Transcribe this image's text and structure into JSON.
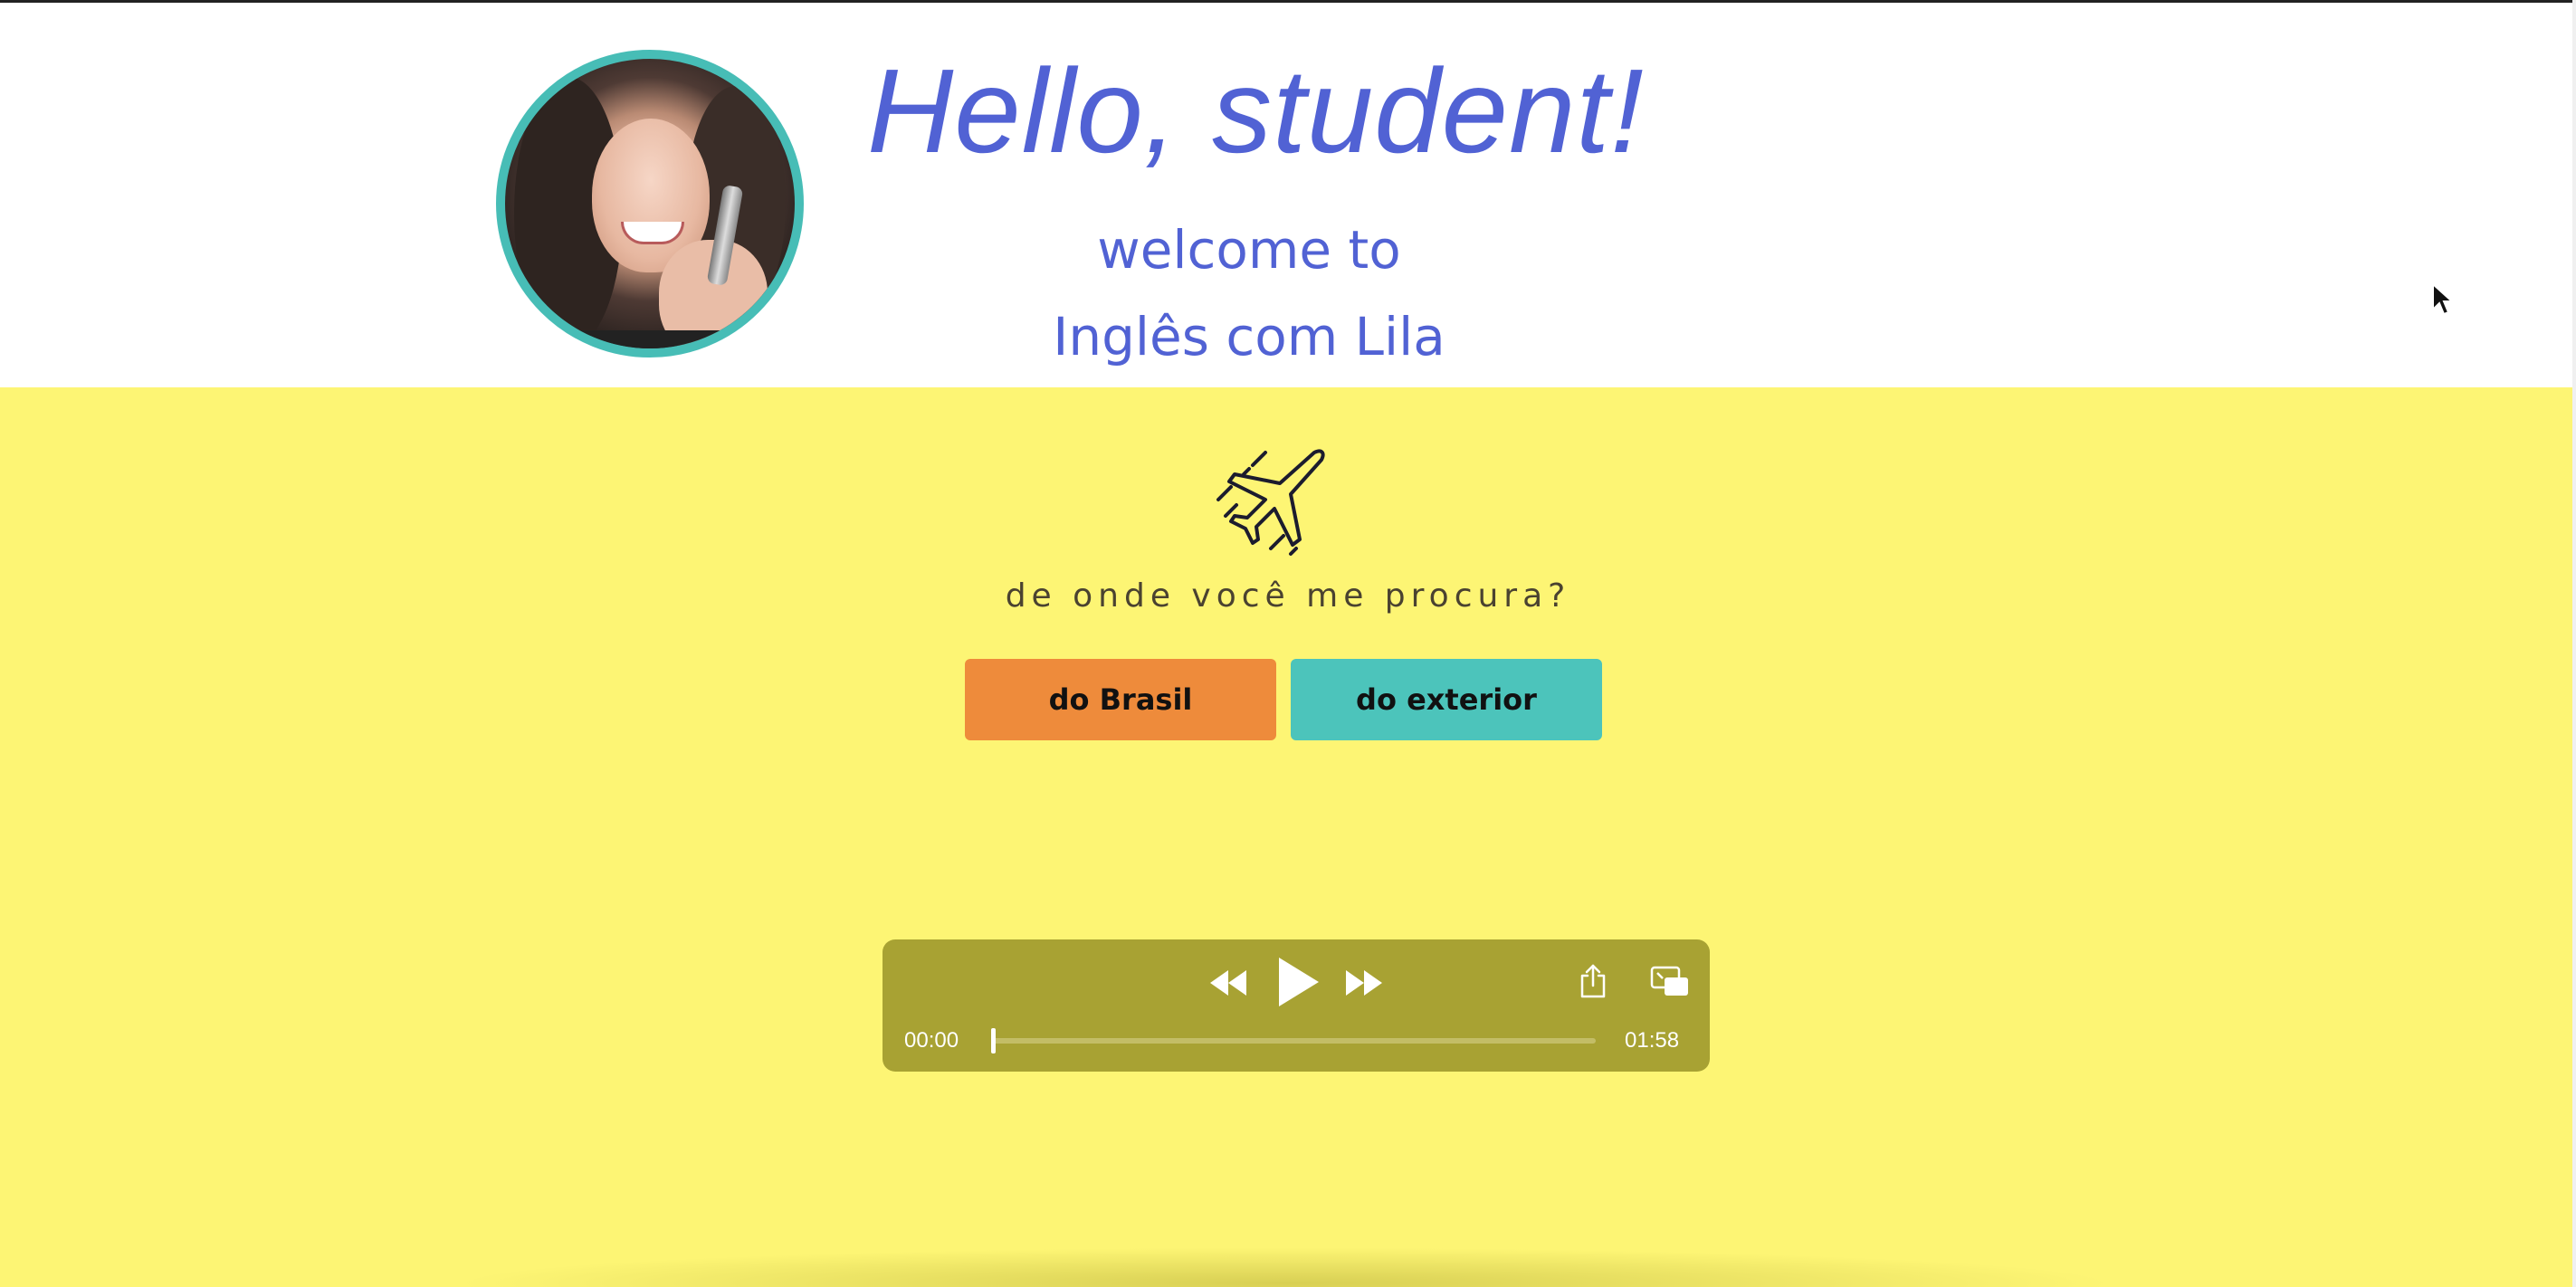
{
  "header": {
    "greeting": "Hello, student!",
    "welcome_line1": "welcome to",
    "welcome_line2": "Inglês com Lila"
  },
  "main": {
    "question": "de onde você me procura?",
    "buttons": {
      "brasil": "do Brasil",
      "exterior": "do exterior"
    }
  },
  "audio_player": {
    "current_time": "00:00",
    "duration": "01:58",
    "progress": 0.0
  },
  "icons": {
    "plane": "airplane-icon",
    "rewind": "rewind-icon",
    "play": "play-icon",
    "fast_forward": "fast-forward-icon",
    "share": "share-icon",
    "pip": "picture-in-picture-icon",
    "cursor": "mouse-cursor"
  },
  "colors": {
    "title_blue": "#5162d4",
    "yellow_bg": "#fdf574",
    "brasil_orange": "#ee8b3b",
    "exterior_teal": "#4cc4bb",
    "player_olive": "#a8a233",
    "avatar_ring": "#47bdb6"
  }
}
